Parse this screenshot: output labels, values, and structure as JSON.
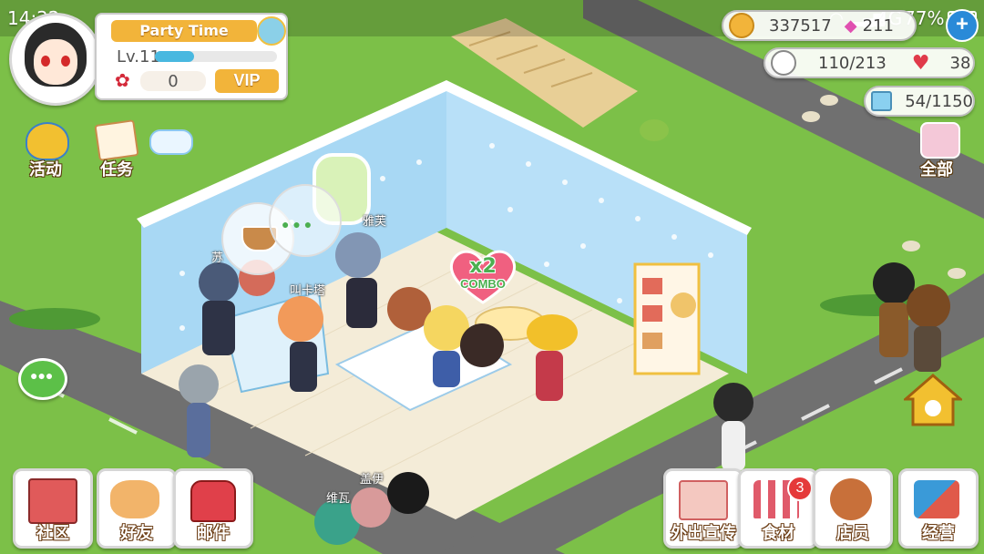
{
  "status_bar": {
    "time": "14:22",
    "signal": "4G",
    "battery": "77%"
  },
  "profile": {
    "event_banner": "Party Time",
    "level": "Lv.11",
    "roses": "0",
    "vip_label": "VIP"
  },
  "resources": {
    "coins": "337517",
    "gems": "211",
    "customers": "110/213",
    "hearts": "38",
    "cards": "54/1150"
  },
  "left_menu": {
    "activity": "活动",
    "tasks": "任务"
  },
  "right_menu": {
    "all": "全部"
  },
  "scene": {
    "combo": "x2",
    "combo_word": "COMBO",
    "npc_names": [
      "雅芙",
      "苏",
      "叫卡塔",
      "维瓦",
      "盖伊"
    ]
  },
  "bottom_bar": {
    "community": "社区",
    "friends": "好友",
    "mail": "邮件",
    "promo": "外出宣传",
    "ingredients": "食材",
    "ingredients_badge": "3",
    "staff": "店员",
    "manage": "经营"
  },
  "colors": {
    "grass": "#7cc048",
    "road": "#6e6e6e",
    "wall": "#a8d8f4",
    "floor": "#f4ecd8",
    "gold": "#f2b43a"
  }
}
